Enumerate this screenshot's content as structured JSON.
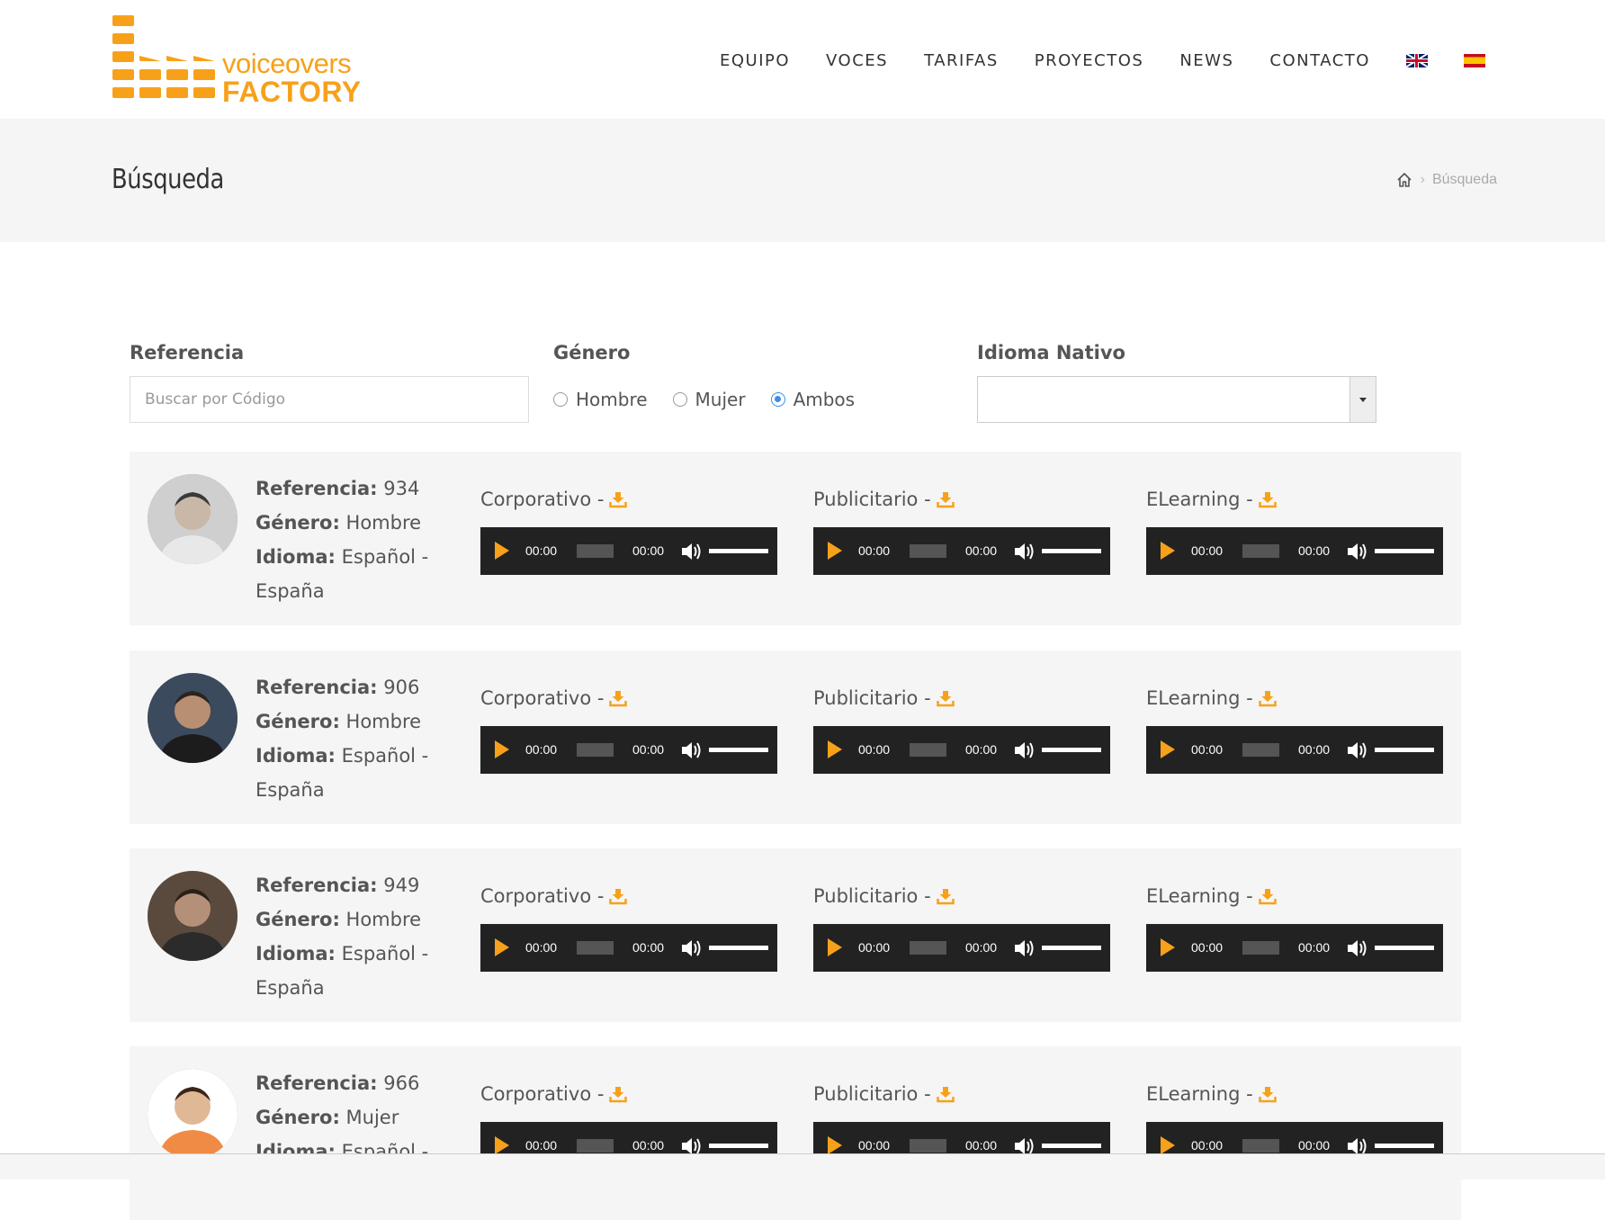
{
  "brand": {
    "line1": "voiceovers",
    "line2": "FACTORY",
    "color": "#f7a11a"
  },
  "nav": {
    "items": [
      "EQUIPO",
      "VOCES",
      "TARIFAS",
      "PROYECTOS",
      "NEWS",
      "CONTACTO"
    ],
    "flags": [
      "uk-flag-icon",
      "spain-flag-icon"
    ]
  },
  "page": {
    "title": "Búsqueda",
    "breadcrumb": "Búsqueda"
  },
  "filters": {
    "reference": {
      "label": "Referencia",
      "placeholder": "Buscar por Código",
      "value": ""
    },
    "gender": {
      "label": "Género",
      "options": [
        "Hombre",
        "Mujer",
        "Ambos"
      ],
      "selected": "Ambos"
    },
    "language": {
      "label": "Idioma Nativo",
      "value": ""
    }
  },
  "labels": {
    "reference": "Referencia:",
    "gender": "Género:",
    "language": "Idioma:"
  },
  "samples": [
    "Corporativo -",
    "Publicitario -",
    "ELearning -"
  ],
  "player": {
    "current": "00:00",
    "duration": "00:00",
    "accent": "#f7a11a"
  },
  "voices": [
    {
      "reference": "934",
      "gender": "Hombre",
      "language": "Español - España"
    },
    {
      "reference": "906",
      "gender": "Hombre",
      "language": "Español - España"
    },
    {
      "reference": "949",
      "gender": "Hombre",
      "language": "Español - España"
    },
    {
      "reference": "966",
      "gender": "Mujer",
      "language": "Español -"
    }
  ]
}
